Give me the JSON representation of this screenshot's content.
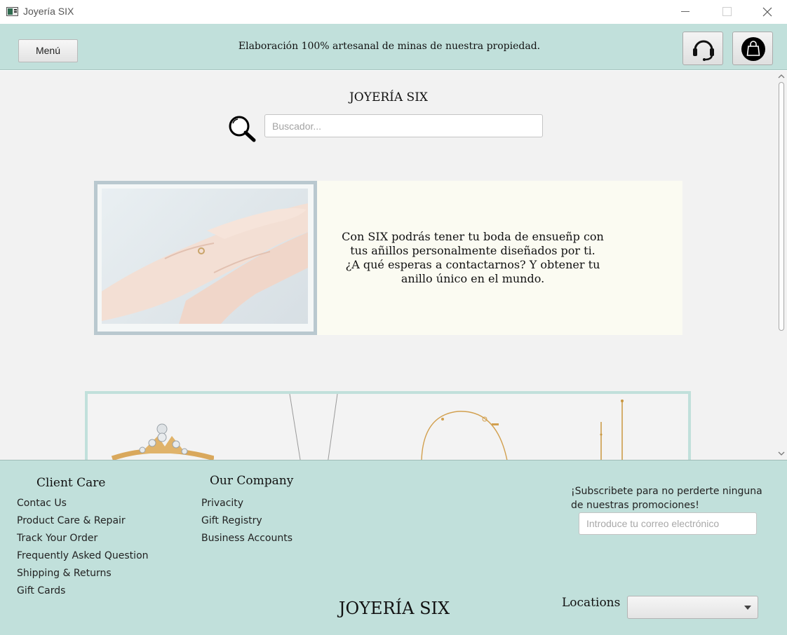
{
  "window": {
    "title": "Joyería SIX"
  },
  "banner": {
    "menu_label": "Menú",
    "tagline": "Elaboración 100% artesanal de minas de nuestra propiedad.",
    "support_icon": "headset-icon",
    "bag_icon": "shopping-bag-icon"
  },
  "main": {
    "brand_title": "JOYERÍA SIX",
    "search": {
      "placeholder": "Buscador...",
      "value": ""
    },
    "promo": {
      "image": "hands-placing-ring-photo",
      "text_lines": [
        "Con SIX podrás tener tu boda de ensueñp con",
        "tus añillos personalmente diseñados por ti.",
        "¿A qué esperas a contactarnos? Y obtener tu",
        "anillo único en el mundo."
      ]
    },
    "products": [
      {
        "image": "gold-diamond-ring"
      },
      {
        "image": "silver-chain-necklace"
      },
      {
        "image": "gold-bracelet"
      },
      {
        "image": "gold-drop-earrings"
      }
    ]
  },
  "footer": {
    "client_care": {
      "heading": "Client Care",
      "links": [
        "Contac Us",
        "Product Care & Repair",
        "Track Your Order",
        "Frequently Asked Question",
        "Shipping & Returns",
        "Gift Cards"
      ]
    },
    "our_company": {
      "heading": "Our Company",
      "links": [
        "Privacity",
        "Gift Registry",
        "Business Accounts"
      ]
    },
    "subscribe": {
      "text": "¡Subscribete para no perderte ninguna de nuestras promociones!",
      "placeholder": "Introduce tu correo electrónico",
      "value": ""
    },
    "brand": "JOYERÍA SIX",
    "locations": {
      "label": "Locations",
      "selected": ""
    }
  },
  "colors": {
    "mint": "#c1e0db",
    "page_bg": "#f2f2f2",
    "promo_bg": "#fbfbf2",
    "frame": "#b9c8cf"
  }
}
